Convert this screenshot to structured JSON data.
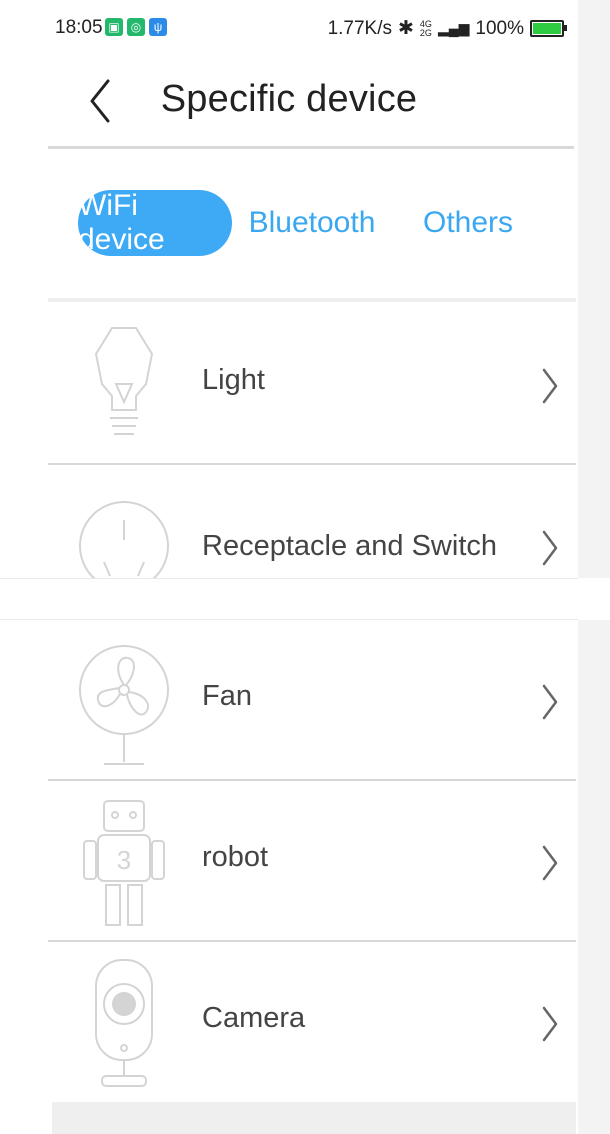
{
  "status_bar": {
    "time": "18:05",
    "network_speed": "1.77K/s",
    "battery_percent": "100%",
    "net_top": "4G",
    "net_bottom": "2G"
  },
  "header": {
    "title": "Specific device"
  },
  "tabs": [
    {
      "label": "WiFi device",
      "active": true
    },
    {
      "label": "Bluetooth",
      "active": false
    },
    {
      "label": "Others",
      "active": false
    }
  ],
  "devices": [
    {
      "label": "Light",
      "icon": "light-bulb-icon"
    },
    {
      "label": "Receptacle and Switch",
      "icon": "socket-icon"
    },
    {
      "label": "Fan",
      "icon": "fan-icon"
    },
    {
      "label": "robot",
      "icon": "robot-icon",
      "badge": "3"
    },
    {
      "label": "Camera",
      "icon": "camera-icon"
    }
  ],
  "colors": {
    "accent": "#3eaaf5",
    "accent_text": "#39a8f1",
    "icon_stroke": "#d4d4d4"
  }
}
